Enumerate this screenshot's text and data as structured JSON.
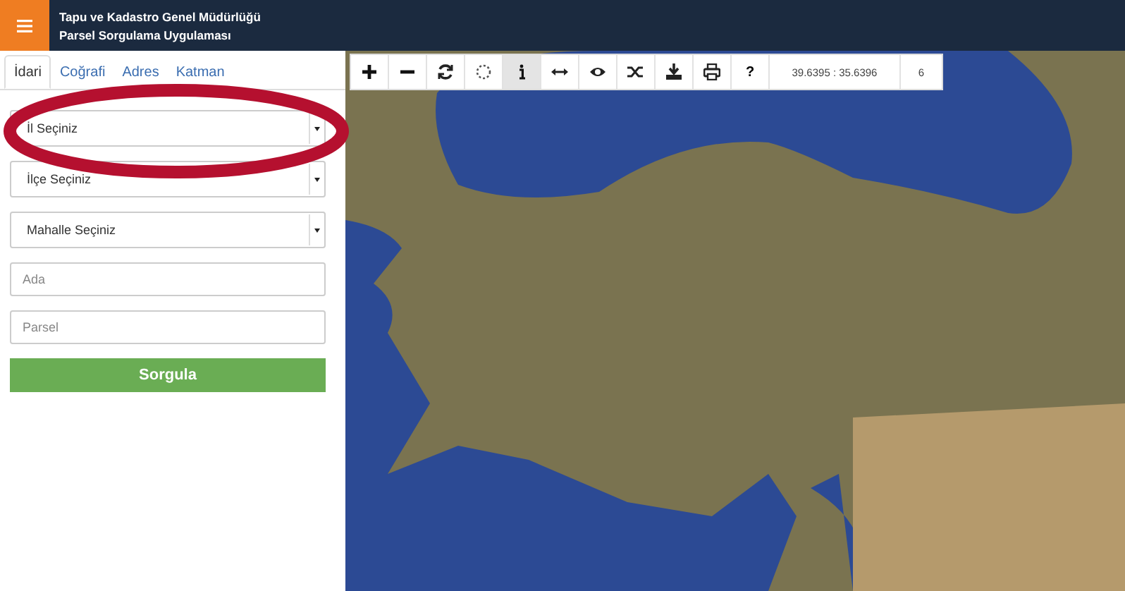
{
  "header": {
    "title_line_1": "Tapu ve Kadastro Genel Müdürlüğü",
    "title_line_2": "Parsel Sorgulama Uygulaması"
  },
  "tabs": [
    {
      "label": "İdari",
      "selected": true
    },
    {
      "label": "Coğrafi",
      "selected": false
    },
    {
      "label": "Adres",
      "selected": false
    },
    {
      "label": "Katman",
      "selected": false
    }
  ],
  "form": {
    "selects": [
      {
        "value": "İl Seçiniz",
        "highlighted": true
      },
      {
        "value": "İlçe Seçiniz",
        "highlighted": false
      },
      {
        "value": "Mahalle Seçiniz",
        "highlighted": false
      }
    ],
    "inputs": [
      {
        "placeholder": "Ada"
      },
      {
        "placeholder": "Parsel"
      }
    ],
    "submit": "Sorgula"
  },
  "toolbar": {
    "tools": [
      {
        "kind": "icon",
        "selected": false
      },
      {
        "kind": "icon",
        "selected": false
      },
      {
        "kind": "icon",
        "selected": false
      },
      {
        "kind": "icon",
        "selected": false
      },
      {
        "kind": "icon",
        "selected": true
      },
      {
        "kind": "icon",
        "selected": false
      },
      {
        "kind": "icon",
        "selected": false
      },
      {
        "kind": "icon",
        "selected": false
      },
      {
        "kind": "icon",
        "selected": false
      },
      {
        "kind": "icon",
        "selected": false
      },
      {
        "kind": "text",
        "label": "?",
        "selected": false
      }
    ],
    "coordinates": "39.6395 : 35.6396",
    "zoom": "6"
  }
}
